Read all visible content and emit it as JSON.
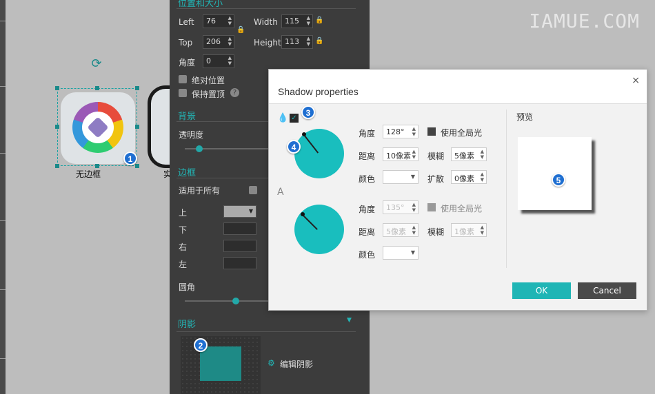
{
  "watermark": "IAMUE.COM",
  "canvas": {
    "label1": "无边框",
    "label2": "实"
  },
  "badges": {
    "b1": "1",
    "b2": "2",
    "b3": "3",
    "b4": "4",
    "b5": "5"
  },
  "panel": {
    "section_pos": "位置和大小",
    "left_label": "Left",
    "left_value": "76",
    "width_label": "Width",
    "width_value": "115",
    "top_label": "Top",
    "top_value": "206",
    "height_label": "Height",
    "height_value": "113",
    "angle_label": "角度",
    "angle_value": "0",
    "absolute_pos": "绝对位置",
    "keep_top": "保持置顶",
    "help": "?",
    "section_bg": "背景",
    "opacity": "透明度",
    "section_border": "边框",
    "apply_all": "适用于所有",
    "top": "上",
    "bottom": "下",
    "right": "右",
    "left": "左",
    "radius": "圆角",
    "section_shadow": "阴影",
    "edit_shadow": "编辑阴影"
  },
  "dialog": {
    "title": "Shadow properties",
    "close": "×",
    "outer": {
      "angle_label": "角度",
      "angle_value": "128°",
      "global_light": "使用全局光",
      "distance_label": "距离",
      "distance_value": "10像素",
      "blur_label": "模糊",
      "blur_value": "5像素",
      "color_label": "颜色",
      "spread_label": "扩散",
      "spread_value": "0像素"
    },
    "inner": {
      "letter": "A",
      "angle_label": "角度",
      "angle_value": "135°",
      "global_light": "使用全局光",
      "distance_label": "距离",
      "distance_value": "5像素",
      "blur_label": "模糊",
      "blur_value": "1像素",
      "color_label": "颜色"
    },
    "preview_label": "预览",
    "ok": "OK",
    "cancel": "Cancel"
  }
}
